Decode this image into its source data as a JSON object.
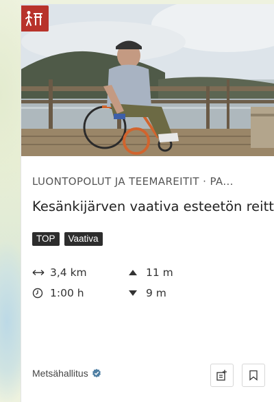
{
  "card": {
    "category": "LUONTOPOLUT JA TEEMAREITIT · PA...",
    "title": "Kesänkijärven vaativa esteetön reitti",
    "tags": [
      "TOP",
      "Vaativa"
    ],
    "stats": {
      "distance": "3,4 km",
      "ascent": "11 m",
      "duration": "1:00 h",
      "descent": "9 m"
    },
    "provider": "Metsähallitus",
    "category_icon": "accessible-hiker-icon",
    "accent_color": "#b8332b",
    "verified_color": "#4f7fa3"
  }
}
